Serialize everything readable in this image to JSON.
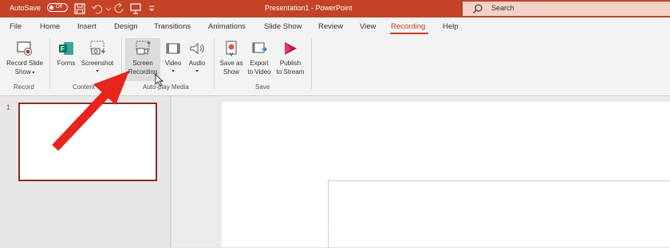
{
  "titlebar": {
    "autosave_label": "AutoSave",
    "autosave_state": "Off",
    "document_title": "Presentation1 - PowerPoint",
    "search_placeholder": "Search",
    "background_color": "#c44327"
  },
  "tabs": [
    {
      "label": "File"
    },
    {
      "label": "Home"
    },
    {
      "label": "Insert"
    },
    {
      "label": "Design"
    },
    {
      "label": "Transitions"
    },
    {
      "label": "Animations"
    },
    {
      "label": "Slide Show"
    },
    {
      "label": "Review"
    },
    {
      "label": "View"
    },
    {
      "label": "Recording",
      "active": true
    },
    {
      "label": "Help"
    }
  ],
  "ribbon": {
    "groups": [
      {
        "name": "Record",
        "buttons": [
          {
            "label": "Record Slide",
            "label2": "Show",
            "icon": "record-slide-show-icon"
          }
        ]
      },
      {
        "name": "Content",
        "buttons": [
          {
            "label": "Forms",
            "icon": "forms-icon"
          },
          {
            "label": "Screenshot",
            "icon": "screenshot-icon"
          }
        ]
      },
      {
        "name": "Auto-play Media",
        "buttons": [
          {
            "label": "Screen",
            "label2": "Recording",
            "icon": "screen-recording-icon",
            "hovered": true
          },
          {
            "label": "Video",
            "icon": "video-icon"
          },
          {
            "label": "Audio",
            "icon": "audio-icon"
          }
        ]
      },
      {
        "name": "Save",
        "buttons": [
          {
            "label": "Save as",
            "label2": "Show",
            "icon": "save-as-show-icon"
          },
          {
            "label": "Export",
            "label2": "to Video",
            "icon": "export-to-video-icon"
          },
          {
            "label": "Publish",
            "label2": "to Stream",
            "icon": "publish-to-stream-icon"
          }
        ]
      }
    ]
  },
  "slides_pane": {
    "slide_number": "1"
  },
  "colors": {
    "accent": "#c44327",
    "annotation_arrow": "#e8241d"
  }
}
